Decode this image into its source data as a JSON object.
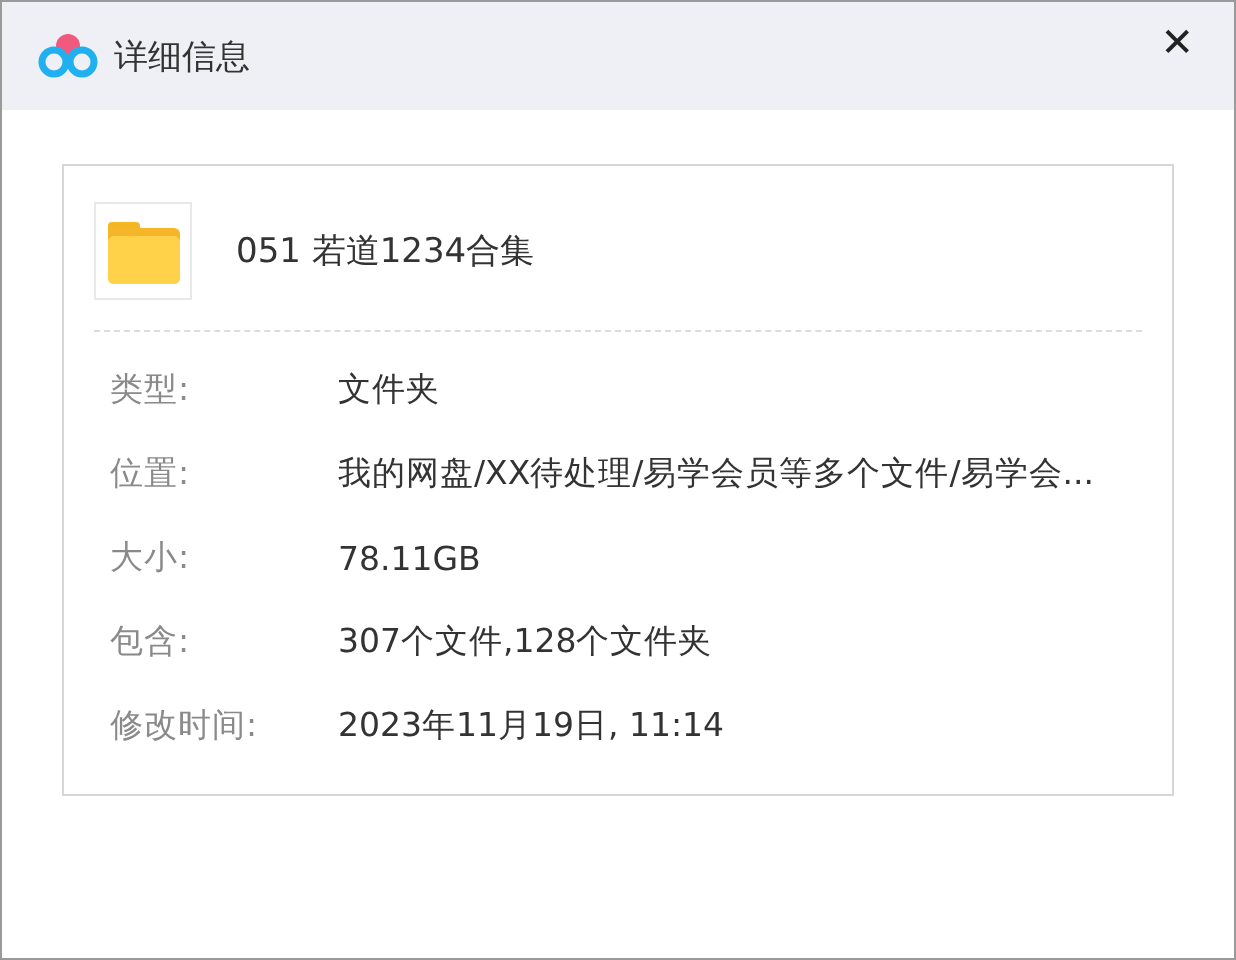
{
  "window": {
    "title": "详细信息",
    "close": "✕"
  },
  "item": {
    "name": "051 若道1234合集"
  },
  "fields": [
    {
      "label": "类型:",
      "value": "文件夹"
    },
    {
      "label": "位置:",
      "value": "我的网盘/XX待处理/易学会员等多个文件/易学会..."
    },
    {
      "label": "大小:",
      "value": "78.11GB"
    },
    {
      "label": "包含:",
      "value": "307个文件,128个文件夹"
    },
    {
      "label": "修改时间:",
      "value": "2023年11月19日, 11:14"
    }
  ]
}
